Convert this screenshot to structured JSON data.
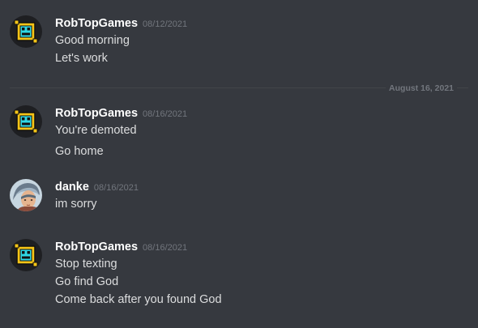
{
  "colors": {
    "background": "#36393f",
    "username": "#ffffff",
    "text": "#dcddde",
    "timestamp": "#72767d",
    "divider": "#42454a",
    "robtop_avatar_yellow": "#f5c518",
    "robtop_avatar_cyan": "#2fd8e6"
  },
  "messages": [
    {
      "author": "RobTopGames",
      "timestamp": "08/12/2021",
      "avatar_icon": "geometry-dash-cube-icon",
      "lines": [
        "Good morning",
        "Let's work"
      ]
    },
    {
      "author": "RobTopGames",
      "timestamp": "08/16/2021",
      "avatar_icon": "geometry-dash-cube-icon",
      "lines": [
        "You're demoted",
        "Go home"
      ]
    },
    {
      "author": "danke",
      "timestamp": "08/16/2021",
      "avatar_icon": "user-portrait-icon",
      "lines": [
        "im sorry"
      ]
    },
    {
      "author": "RobTopGames",
      "timestamp": "08/16/2021",
      "avatar_icon": "geometry-dash-cube-icon",
      "lines": [
        "Stop texting",
        "Go find God",
        "Come back after you found God"
      ]
    }
  ],
  "date_divider": {
    "label": "August 16, 2021"
  }
}
